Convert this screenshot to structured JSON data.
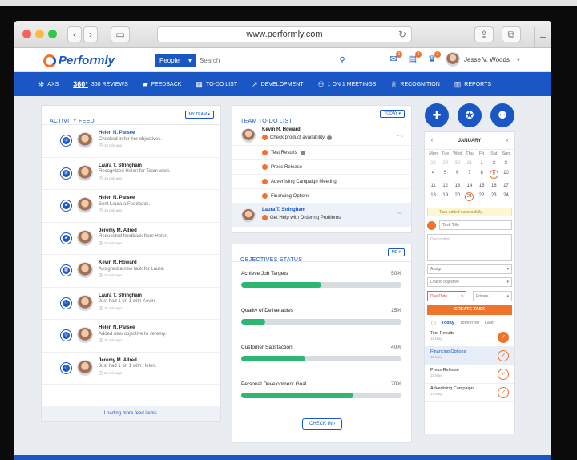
{
  "browser": {
    "url": "www.performly.com",
    "back": "‹",
    "forward": "›",
    "sidebar_icon": "▭",
    "reload_icon": "↻",
    "share_icon": "⇪",
    "tabs_icon": "⧉",
    "new_tab": "+"
  },
  "header": {
    "logo": "Performly",
    "search_scope": "People",
    "search_caret": "▾",
    "search_placeholder": "Search",
    "search_icon": "⚲",
    "badges": [
      "1",
      "4",
      "2"
    ],
    "icons": [
      "mail-icon",
      "clipboard-icon",
      "trophy-icon"
    ],
    "icon_glyphs": [
      "✉",
      "▤",
      "♛"
    ],
    "user_name": "Jesse V. Woods",
    "user_caret": "▾"
  },
  "nav": [
    {
      "icon": "⛯",
      "label": "AXS"
    },
    {
      "icon": "360°",
      "label": "360 REVIEWS"
    },
    {
      "icon": "▰",
      "label": "FEEDBACK"
    },
    {
      "icon": "▦",
      "label": "TO-DO LIST"
    },
    {
      "icon": "↗",
      "label": "DEVELOPMENT"
    },
    {
      "icon": "⚇",
      "label": "1 ON 1 MEETINGS"
    },
    {
      "icon": "♕",
      "label": "RECOGNITION"
    },
    {
      "icon": "▥",
      "label": "REPORTS"
    }
  ],
  "feed": {
    "title": "ACTIVITY FEED",
    "filter": "MY TEAM ▾",
    "items": [
      {
        "icon": "◎",
        "name": "Helen N. Parsee",
        "name_blue": true,
        "action": "Checked in for her objectives.",
        "time": "🕓 15 min ago"
      },
      {
        "icon": "⊞",
        "name": "Laura T. Stringham",
        "name_blue": false,
        "action": "Recognized Helen for Team work.",
        "time": "🕓 15 min ago"
      },
      {
        "icon": "▰",
        "name": "Helen N. Parsee",
        "name_blue": false,
        "action": "Sent Laura a Feedback.",
        "time": "🕓 15 min ago"
      },
      {
        "icon": "▰",
        "name": "Jeremy M. Allred",
        "name_blue": false,
        "action": "Requested feedback from Helen.",
        "time": "🕓 15 min ago"
      },
      {
        "icon": "▦",
        "name": "Kevin R. Howard",
        "name_blue": false,
        "action": "Assigned a new task for Laura.",
        "time": "🕓 15 min ago"
      },
      {
        "icon": "⚇",
        "name": "Laura T. Stringham",
        "name_blue": false,
        "action": "Just had 1 on 1 with Kevin.",
        "time": "🕓 15 min ago"
      },
      {
        "icon": "◎",
        "name": "Helen N. Parsee",
        "name_blue": false,
        "action": "Added new objective to Jeremy.",
        "time": "🕓 15 min ago"
      },
      {
        "icon": "⚇",
        "name": "Jeremy M. Allred",
        "name_blue": false,
        "action": "Just had 1 on 1 with Helen.",
        "time": "🕓 15 min ago"
      }
    ],
    "more": "Loading more feed items."
  },
  "todo": {
    "title": "TEAM TO-DO LIST",
    "filter": "TODAY ▾",
    "group1_name": "Kevin R. Howard",
    "group1_task": "Check product availability",
    "tasks": [
      "Test Results",
      "Press Release",
      "Advertising Campaign Meeting",
      "Financing Options"
    ],
    "group2_name": "Laura T. Stringham",
    "group2_task": "Get Help with Ordering Problems",
    "chev_up": "︿",
    "chev_down": "﹀"
  },
  "objectives": {
    "title": "OBJECTIVES STATUS",
    "filter": "ME ▾",
    "items": [
      {
        "label": "Achieve Job Targets",
        "value": "50%",
        "progress": 0.5
      },
      {
        "label": "Quality of Deliverables",
        "value": "15%",
        "progress": 0.15
      },
      {
        "label": "Customer Satisfaction",
        "value": "40%",
        "progress": 0.4
      },
      {
        "label": "Personal Development Goal",
        "value": "70%",
        "progress": 0.7
      }
    ],
    "checkin": "CHECK IN ›"
  },
  "quick_actions": [
    "add-feedback-icon",
    "add-objective-icon",
    "add-meeting-icon"
  ],
  "quick_glyphs": [
    "✚",
    "✪",
    "⚉"
  ],
  "calendar": {
    "prev": "‹",
    "next": "›",
    "month": "JANUARY",
    "weekdays": [
      "Mon",
      "Tue",
      "Wed",
      "Thu",
      "Fri",
      "Sat",
      "Sun"
    ],
    "days": [
      "28",
      "29",
      "30",
      "31",
      "1",
      "2",
      "3",
      "4",
      "5",
      "6",
      "7",
      "8",
      "9",
      "10",
      "11",
      "12",
      "13",
      "14",
      "15",
      "16",
      "17",
      "18",
      "19",
      "20",
      "21",
      "22",
      "23",
      "24"
    ],
    "muted_count": 4,
    "ringed": [
      "9",
      "21"
    ]
  },
  "task_form": {
    "toast": "Task added successfully",
    "title_placeholder": "Task Title",
    "desc_placeholder": "Description",
    "assign": "Assign",
    "link": "Link to objective",
    "due": "Due Date",
    "privacy": "Private",
    "caret": "▾",
    "create": "CREATE TASK"
  },
  "side_tabs": [
    "Today",
    "Tomorrow",
    "Later"
  ],
  "side_tasks": [
    {
      "name": "Test Results",
      "time": "11 May",
      "done": true,
      "hl": false
    },
    {
      "name": "Financing Options",
      "time": "11 May",
      "done": false,
      "hl": true
    },
    {
      "name": "Press Release",
      "time": "11 May",
      "done": false,
      "hl": false
    },
    {
      "name": "Advertising Campaign...",
      "time": "11 May",
      "done": false,
      "hl": false
    }
  ],
  "colors": {
    "primary": "#1a56c4",
    "accent": "#f0732b",
    "progress": "#2eb773"
  }
}
